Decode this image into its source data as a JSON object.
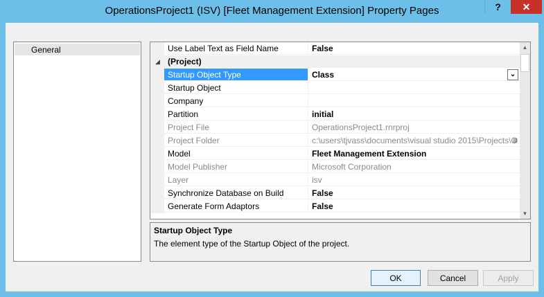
{
  "window": {
    "title": "OperationsProject1 (ISV) [Fleet Management Extension] Property Pages",
    "help_label": "?",
    "close_label": "✕"
  },
  "left_pane": {
    "items": [
      {
        "label": "General"
      }
    ]
  },
  "properties": {
    "rows": [
      {
        "name": "Use Label Text as Field Name",
        "value": "False"
      },
      {
        "name": "(Project)",
        "value": ""
      },
      {
        "name": "Startup Object Type",
        "value": "Class"
      },
      {
        "name": "Startup Object",
        "value": ""
      },
      {
        "name": "Company",
        "value": ""
      },
      {
        "name": "Partition",
        "value": "initial"
      },
      {
        "name": "Project File",
        "value": "OperationsProject1.rnrproj"
      },
      {
        "name": "Project Folder",
        "value": "c:\\users\\tjvass\\documents\\visual studio 2015\\Projects\\O"
      },
      {
        "name": "Model",
        "value": "Fleet Management Extension"
      },
      {
        "name": "Model Publisher",
        "value": "Microsoft Corporation"
      },
      {
        "name": "Layer",
        "value": "isv"
      },
      {
        "name": "Synchronize Database on Build",
        "value": "False"
      },
      {
        "name": "Generate Form Adaptors",
        "value": "False"
      }
    ]
  },
  "description": {
    "title": "Startup Object Type",
    "text": "The element type of the Startup Object of the project."
  },
  "buttons": {
    "ok": "OK",
    "cancel": "Cancel",
    "apply": "Apply"
  },
  "icons": {
    "expander": "collapse-triangle-icon",
    "dropdown": "chevron-down-icon",
    "ellipsis": "ellipsis-icon"
  },
  "colors": {
    "titlebar": "#6bbfe8",
    "close": "#c7312a",
    "selection": "#3399ff"
  }
}
